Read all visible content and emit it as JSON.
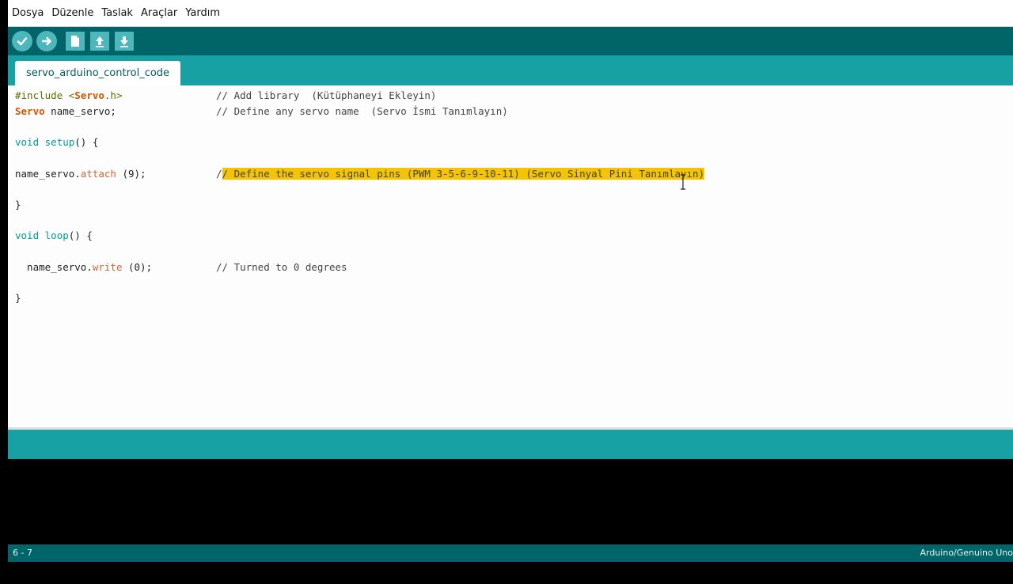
{
  "menu": [
    "Dosya",
    "Düzenle",
    "Taslak",
    "Araçlar",
    "Yardım"
  ],
  "toolbar": {
    "verify_icon": "check-icon",
    "upload_icon": "arrow-right-icon",
    "new_icon": "new-file-icon",
    "open_icon": "open-up-icon",
    "save_icon": "save-down-icon"
  },
  "tab": {
    "label": "servo_arduino_control_code"
  },
  "code": {
    "l1_pre": "#include <",
    "l1_lib": "Servo",
    "l1_post": ".h>",
    "l1_comment": "// Add library  (Kütüphaneyi Ekleyin)",
    "l2_type": "Servo",
    "l2_rest": " name_servo;",
    "l2_comment": "// Define any servo name  (Servo İsmi Tanımlayın)",
    "l3_kw": "void",
    "l3_fn": "setup",
    "l3_rest": "() {",
    "l4_obj": "name_servo.",
    "l4_fn": "attach",
    "l4_rest": " (9);",
    "l4_comment_pre": "/",
    "l4_comment_hl": "/ Define the servo signal pins (PWM 3-5-6-9-10-11) (Servo Sinyal Pini Tanımlayın)",
    "l5": "}",
    "l6_kw": "void",
    "l6_fn": "loop",
    "l6_rest": "() {",
    "l7_obj": "  name_servo.",
    "l7_fn": "write",
    "l7_rest": " (0);",
    "l7_comment": "// Turned to 0 degrees",
    "l8": "}"
  },
  "status": {
    "line": "6 - 7",
    "board": "Arduino/Genuino Uno"
  },
  "colors": {
    "toolbar_bg": "#006468",
    "tabbar_bg": "#17a1a5",
    "highlight": "#f5c400",
    "keyword_orange": "#d35400",
    "keyword_teal": "#00979c"
  }
}
